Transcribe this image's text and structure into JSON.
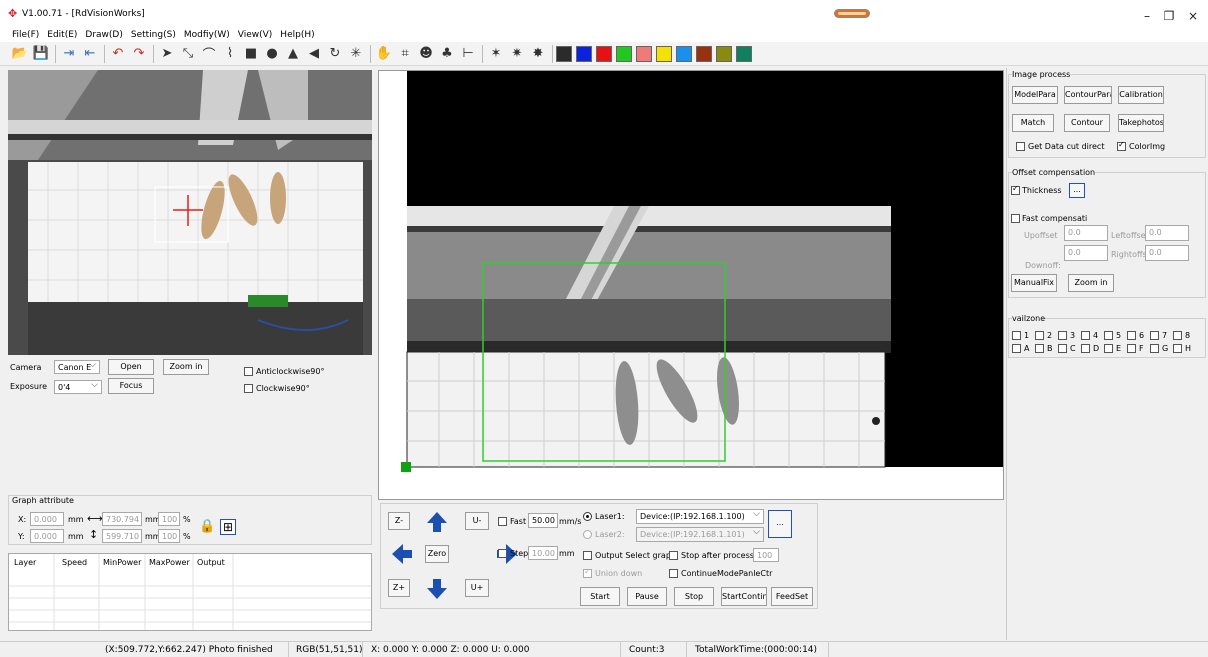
{
  "app": {
    "logo_icon": "rdworks-logo-icon",
    "title": "V1.00.71 - [RdVisionWorks]"
  },
  "menu": [
    "File(F)",
    "Edit(E)",
    "Draw(D)",
    "Setting(S)",
    "Modfiy(W)",
    "View(V)",
    "Help(H)"
  ],
  "window_controls": {
    "minimize": "–",
    "restore": "❐",
    "close": "×"
  },
  "toolbar": {
    "icons": [
      "open-folder-icon",
      "save-icon",
      "import-icon",
      "export-icon",
      "undo-icon",
      "redo-icon",
      "select-arrow-icon",
      "node-edit-icon",
      "arc-icon",
      "polyline-icon",
      "rectangle-icon",
      "ellipse-icon",
      "mirror-icon",
      "triangle-icon",
      "rotate-icon",
      "star-icon",
      "hand-pan-icon",
      "frame-icon",
      "user-icon",
      "tree-icon",
      "measure-icon",
      "sparkle-icon",
      "sparkle2-icon",
      "sparkle3-icon"
    ],
    "glyphs": [
      "📂",
      "💾",
      "⇥",
      "⇤",
      "↶",
      "↷",
      "➤",
      "⤡",
      "⌒",
      "⌇",
      "■",
      "●",
      "▲",
      "◀",
      "↻",
      "✳",
      "✋",
      "⌗",
      "☻",
      "♣",
      "⊢",
      "✶",
      "✷",
      "✸"
    ],
    "colors": [
      "#2b2b2b",
      "#0a22e0",
      "#e81010",
      "#20c820",
      "#f07a7a",
      "#f6e000",
      "#1890f0",
      "#993010",
      "#8a8a10",
      "#108060"
    ]
  },
  "camera_panel": {
    "camera_label": "Camera",
    "camera_value": "Canon E",
    "open_btn": "Open",
    "zoom_btn": "Zoom in",
    "exposure_label": "Exposure",
    "exposure_value": "0'4",
    "focus_btn": "Focus",
    "anticlockwise": "Anticlockwise90°",
    "clockwise": "Clockwise90°"
  },
  "graph_attribute": {
    "title": "Graph attribute",
    "x_label": "X:",
    "x_value": "0.000",
    "x_unit": "mm",
    "w_value": "730.794",
    "w_unit": "mm",
    "w_pct": "100",
    "pct_sign": "%",
    "y_label": "Y:",
    "y_value": "0.000",
    "y_unit": "mm",
    "h_value": "599.710",
    "h_unit": "mm",
    "h_pct": "100"
  },
  "layer_table": {
    "headers": [
      "Layer",
      "Speed",
      "MinPower",
      "MaxPower",
      "Output"
    ]
  },
  "motion": {
    "z_minus": "Z-",
    "z_plus": "Z+",
    "u_minus": "U-",
    "u_plus": "U+",
    "zero": "Zero",
    "fast_label": "Fast",
    "fast_value": "50.00",
    "fast_unit": "mm/s",
    "step_label": "Step",
    "step_value": "10.00",
    "step_unit": "mm"
  },
  "laser": {
    "laser1": "Laser1:",
    "laser1_device": "Device:(IP:192.168.1.100)",
    "laser2": "Laser2:",
    "laser2_device": "Device:(IP:192.168.1.101)",
    "more_btn": "...",
    "output_select": "Output Select grapl",
    "stop_after": "Stop after processe",
    "stop_value": "100",
    "union_down": "Union down",
    "continue_mode": "ContinueModePanleCtr",
    "start": "Start",
    "pause": "Pause",
    "stop": "Stop",
    "start_contin": "StartContin",
    "feedset": "FeedSet"
  },
  "image_process": {
    "title": "Image process",
    "model_para": "ModelPara",
    "contour_para": "ContourPara",
    "calibration": "Calibration",
    "match": "Match",
    "contour": "Contour",
    "takephotos": "Takephotos",
    "get_data": "Get Data cut direct",
    "color_img": "ColorImg"
  },
  "offset": {
    "title": "Offset compensation",
    "thickness": "Thickness",
    "dots": "...",
    "fast_comp": "Fast compensati",
    "upoffset": "Upoffset",
    "upoffset_value": "0.0",
    "leftoffse": "Leftoffse",
    "leftoffse_value": "0.0",
    "downoff": "Downoff:",
    "downoff_value": "0.0",
    "rightoffs": "Rightoffs",
    "rightoffs_value": "0.0",
    "manualfix": "ManualFix",
    "zoom_in": "Zoom in"
  },
  "vailzone": {
    "title": "vailzone",
    "row1": [
      "1",
      "2",
      "3",
      "4",
      "5",
      "6",
      "7",
      "8"
    ],
    "row2": [
      "A",
      "B",
      "C",
      "D",
      "E",
      "F",
      "G",
      "H"
    ]
  },
  "status": {
    "coords": "(X:509.772,Y:662.247) Photo finished",
    "rgb": "RGB(51,51,51)",
    "axes": "X: 0.000   Y: 0.000   Z: 0.000 U: 0.000",
    "count": "Count:3",
    "worktime": "TotalWorkTime:(000:00:14)"
  }
}
